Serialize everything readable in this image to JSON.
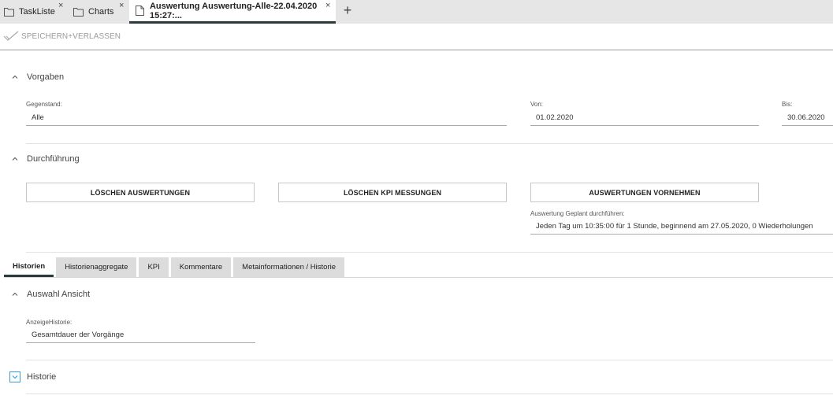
{
  "tabs": [
    {
      "label": "TaskListe",
      "icon": "folder-icon",
      "active": false
    },
    {
      "label": "Charts",
      "icon": "folder-icon",
      "active": false
    },
    {
      "label": "Auswertung Auswertung-Alle-22.04.2020 15:27:...",
      "icon": "document-icon",
      "active": true
    }
  ],
  "tab_close": "×",
  "tab_add": "+",
  "toolbar": {
    "save_exit_label": "SPEICHERN+VERLASSEN"
  },
  "vorgaben": {
    "title": "Vorgaben",
    "gegenstand_label": "Gegenstand:",
    "gegenstand_value": "Alle",
    "von_label": "Von:",
    "von_value": "01.02.2020",
    "bis_label": "Bis:",
    "bis_value": "30.06.2020"
  },
  "durchfuehrung": {
    "title": "Durchführung",
    "btn_delete_evaluations": "LÖSCHEN AUSWERTUNGEN",
    "btn_delete_kpi": "LÖSCHEN KPI MESSUNGEN",
    "btn_run_evaluations": "AUSWERTUNGEN VORNEHMEN",
    "schedule_label": "Auswertung Geplant durchführen:",
    "schedule_value": "Jeden Tag um 10:35:00 für 1 Stunde, beginnend am 27.05.2020, 0 Wiederholungen"
  },
  "inner_tabs": [
    "Historien",
    "Historienaggregate",
    "KPI",
    "Kommentare",
    "Metainformationen / Historie"
  ],
  "auswahl": {
    "title": "Auswahl Ansicht",
    "anzeige_label": "AnzeigeHistorie:",
    "anzeige_value": "Gesamtdauer der Vorgänge"
  },
  "historie": {
    "title": "Historie"
  },
  "colors": {
    "accent": "#2b3a3a",
    "tabbar": "#e6e6e6",
    "expand_box": "#3a9bd8"
  }
}
